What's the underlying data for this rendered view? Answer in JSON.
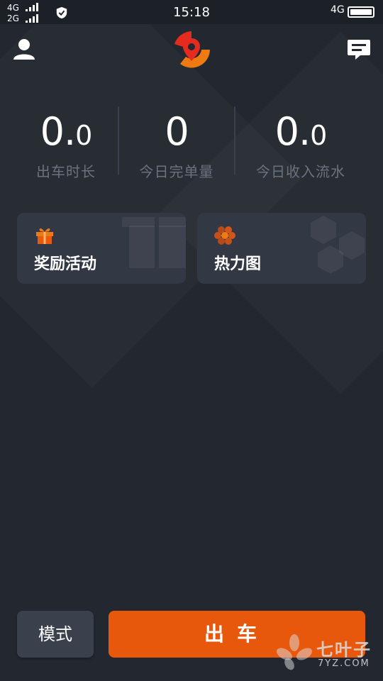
{
  "status_bar": {
    "network_1": "4G",
    "network_2": "2G",
    "time": "15:18",
    "network_right": "4G"
  },
  "header": {
    "user_icon": "user-icon",
    "logo_icon": "map-pin-logo-icon",
    "message_icon": "message-icon"
  },
  "stats": [
    {
      "value_main": "0.",
      "value_dec": "0",
      "label": "出车时长"
    },
    {
      "value_main": "0",
      "value_dec": "",
      "label": "今日完单量"
    },
    {
      "value_main": "0.",
      "value_dec": "0",
      "label": "今日收入流水"
    }
  ],
  "cards": [
    {
      "title": "奖励活动",
      "icon": "gift-icon"
    },
    {
      "title": "热力图",
      "icon": "hexagon-heatmap-icon"
    }
  ],
  "bottom": {
    "mode_label": "模式",
    "go_label": "出车"
  },
  "watermark": {
    "text": "七叶子",
    "sub": "7YZ.COM"
  },
  "colors": {
    "background": "#232830",
    "card": "#323844",
    "accent": "#e8580c",
    "label": "#6a7280"
  }
}
